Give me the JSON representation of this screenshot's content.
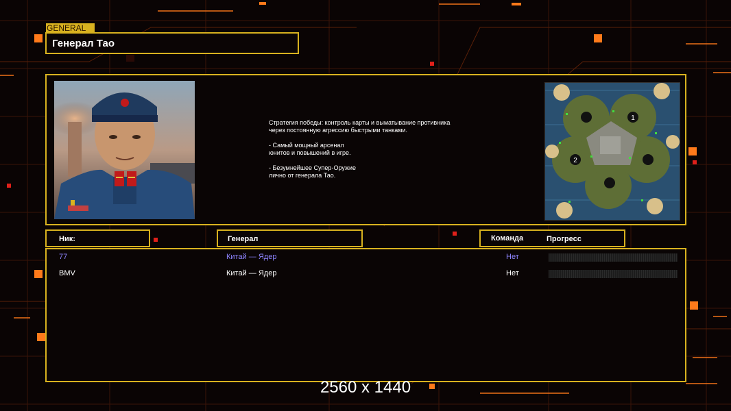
{
  "general_tag": "GENERAL",
  "general_name": "Генерал Тао",
  "description": "Стратегия победы: контроль карты и выматывание противника\n через постоянную агрессию быстрыми танками.\n\n- Самый мощный арсенал\nюнитов и повышений в игре.\n\n- Безумнейшее Супер-Оружие\nлично от генерала Тао.",
  "headers": {
    "nick": "Ник:",
    "general": "Генерал",
    "team": "Команда",
    "progress": "Прогресс"
  },
  "players": [
    {
      "nick": "77",
      "general": "Китай — Ядер",
      "team": "Нет",
      "color": "#8f85ff",
      "progress": 0
    },
    {
      "nick": "BMV",
      "general": "Китай — Ядер",
      "team": "Нет",
      "color": "#ffffff",
      "progress": 0
    }
  ],
  "map_markers": [
    "1",
    "2"
  ],
  "resolution_label": "2560 x 1440",
  "colors": {
    "accent": "#d9b21f",
    "background": "#0a0404",
    "grid_orange": "#ff7a1a"
  }
}
